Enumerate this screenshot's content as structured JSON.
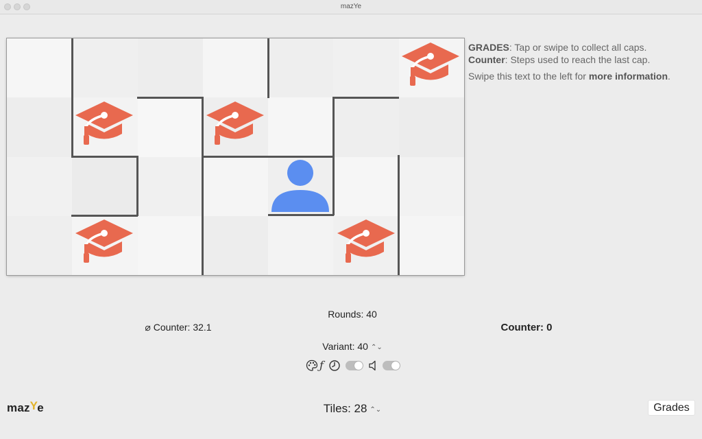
{
  "window": {
    "title": "mazYe"
  },
  "info": {
    "grades_label": "GRADES",
    "grades_text": ": Tap or swipe to collect all caps.",
    "counter_label": "Counter",
    "counter_text": ": Steps used to reach the last cap.",
    "swipe_prefix": "Swipe this text to the left for ",
    "swipe_link": "more information",
    "swipe_suffix": "."
  },
  "stats": {
    "avg_counter": "⌀ Counter: 32.1",
    "rounds": "Rounds: 40",
    "counter": "Counter: 0",
    "variant": "Variant: 40",
    "tiles": "Tiles: 28"
  },
  "toolbar": {
    "icons": [
      "palette-icon",
      "function-icon",
      "clock-icon",
      "speaker-icon"
    ]
  },
  "logo": {
    "a": "maz",
    "b": "Y",
    "c": "e"
  },
  "buttons": {
    "grades": "Grades"
  },
  "colors": {
    "cap": "#e8694f",
    "player": "#5b8ef0",
    "wall": "#555555",
    "logo_y": "#e2b32a"
  }
}
